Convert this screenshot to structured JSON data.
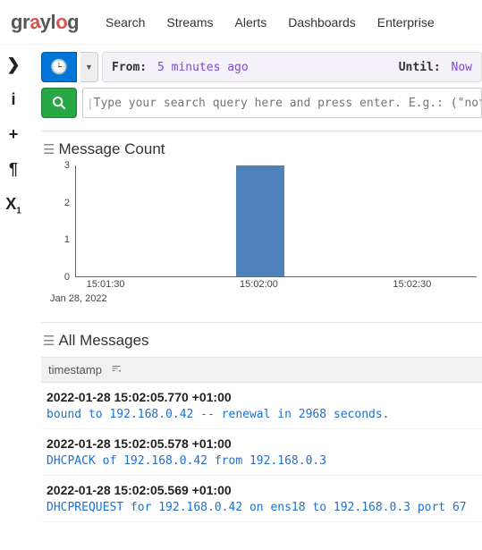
{
  "nav": {
    "brand": "graylog",
    "items": [
      "Search",
      "Streams",
      "Alerts",
      "Dashboards",
      "Enterprise"
    ]
  },
  "timebar": {
    "from_label": "From:",
    "from_value": "5 minutes ago",
    "until_label": "Until:",
    "until_value": "Now"
  },
  "search": {
    "placeholder": "Type your search query here and press enter. E.g.: (\"not foun"
  },
  "panels": {
    "messageCountTitle": "Message Count",
    "allMessagesTitle": "All Messages"
  },
  "messagesHeader": {
    "timestamp": "timestamp"
  },
  "messages": [
    {
      "ts": "2022-01-28 15:02:05.770 +01:00",
      "text": "bound to 192.168.0.42 -- renewal in 2968 seconds."
    },
    {
      "ts": "2022-01-28 15:02:05.578 +01:00",
      "text": "DHCPACK of 192.168.0.42 from 192.168.0.3"
    },
    {
      "ts": "2022-01-28 15:02:05.569 +01:00",
      "text": "DHCPREQUEST for 192.168.0.42 on ens18 to 192.168.0.3 port 67"
    }
  ],
  "chart_data": {
    "type": "bar",
    "x": [
      "15:01:30",
      "15:02:00",
      "15:02:30"
    ],
    "values": [
      0,
      3,
      0
    ],
    "yticks": [
      0,
      1,
      2,
      3
    ],
    "ylim": [
      0,
      3
    ],
    "date_label": "Jan 28, 2022",
    "title": "Message Count"
  }
}
